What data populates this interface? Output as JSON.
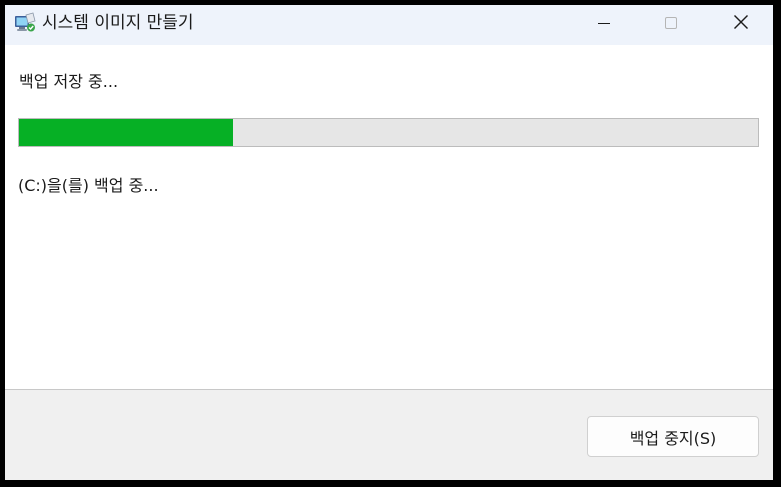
{
  "window": {
    "title": "시스템 이미지 만들기",
    "app_icon": "backup-computer-icon",
    "controls": {
      "minimize_icon": "minimize-icon",
      "maximize_icon": "maximize-icon",
      "close_icon": "close-icon"
    }
  },
  "main": {
    "status_heading": "백업 저장 중...",
    "progress": 0.29,
    "status_detail": "(C:)을(를) 백업 중..."
  },
  "footer": {
    "stop_button_label": "백업 중지(S)"
  },
  "colors": {
    "progress_fill": "#06b025",
    "progress_track": "#e6e6e6",
    "titlebar": "#eef3fb",
    "footer": "#f0f0f0"
  }
}
